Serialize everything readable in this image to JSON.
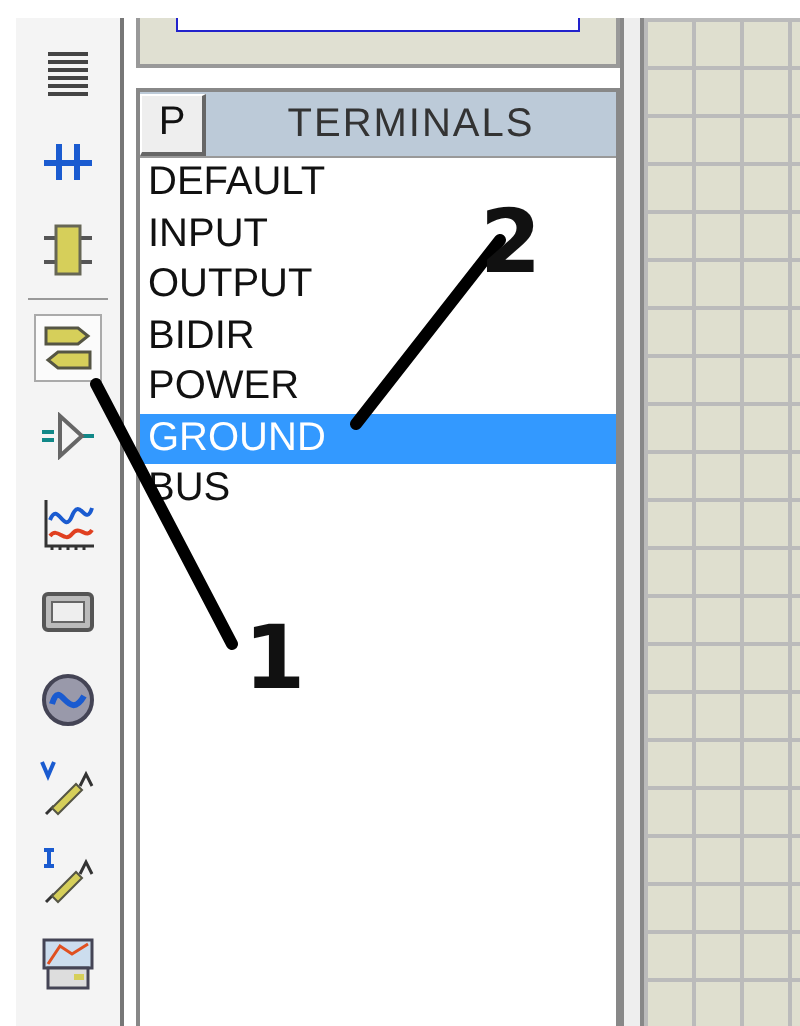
{
  "toolbar": [
    {
      "kind": "text",
      "selected": false
    },
    {
      "kind": "wire",
      "selected": false
    },
    {
      "kind": "component",
      "selected": false
    },
    {
      "kind": "terminal",
      "selected": true
    },
    {
      "kind": "pin",
      "selected": false
    },
    {
      "kind": "graph",
      "selected": false
    },
    {
      "kind": "tape",
      "selected": false
    },
    {
      "kind": "generator",
      "selected": false
    },
    {
      "kind": "voltage",
      "selected": false
    },
    {
      "kind": "current",
      "selected": false
    },
    {
      "kind": "instrument",
      "selected": false
    }
  ],
  "panel": {
    "mode_button": "P",
    "title": "TERMINALS",
    "items": [
      {
        "label": "DEFAULT",
        "selected": false
      },
      {
        "label": "INPUT",
        "selected": false
      },
      {
        "label": "OUTPUT",
        "selected": false
      },
      {
        "label": "BIDIR",
        "selected": false
      },
      {
        "label": "POWER",
        "selected": false
      },
      {
        "label": "GROUND",
        "selected": true
      },
      {
        "label": "BUS",
        "selected": false
      }
    ]
  },
  "annotations": [
    {
      "label": "1"
    },
    {
      "label": "2"
    }
  ]
}
